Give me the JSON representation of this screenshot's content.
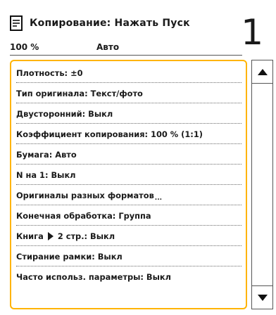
{
  "header": {
    "title": "Копирование: Нажать Пуск",
    "icon": "copy-document-icon",
    "ratio": "100 %",
    "paper_mode": "Авто",
    "copies": "1"
  },
  "settings": {
    "density": "Плотность: ±0",
    "original_type": "Тип оригинала: Текст/фото",
    "two_sided": "Двусторонний: Выкл",
    "copy_ratio": "Коэффициент копирования: 100 % (1:1)",
    "paper": "Бумага: Авто",
    "n_on_1": "N на 1: Выкл",
    "mixed_originals": "Оригиналы разных форматов",
    "mixed_originals_suffix": "...",
    "finishing": "Конечная обработка: Группа",
    "book_prefix": "Книга",
    "book_suffix": "2 стр.: Выкл",
    "erase_frame": "Стирание рамки: Выкл",
    "favorites": "Часто использ. параметры: Выкл"
  },
  "colors": {
    "accent": "#ffb400"
  }
}
